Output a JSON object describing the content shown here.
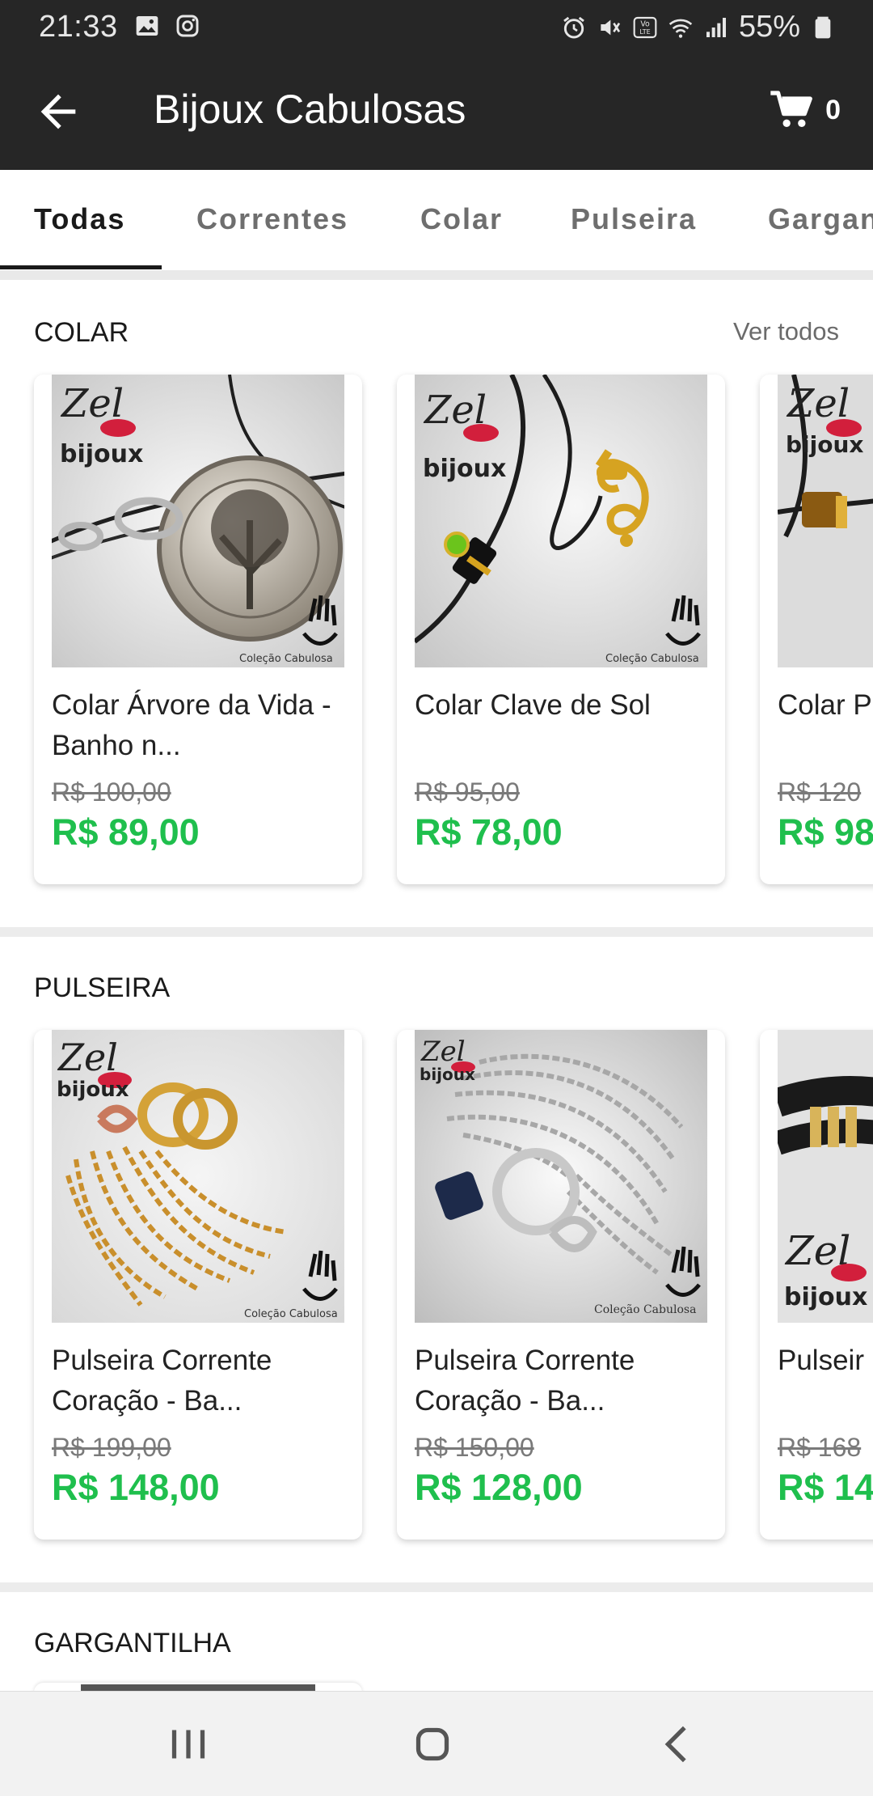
{
  "status": {
    "time": "21:33",
    "battery": "55%"
  },
  "app_bar": {
    "title": "Bijoux Cabulosas",
    "cart_count": "0"
  },
  "tabs": [
    {
      "label": "Todas"
    },
    {
      "label": "Correntes"
    },
    {
      "label": "Colar"
    },
    {
      "label": "Pulseira"
    },
    {
      "label": "Gargan"
    }
  ],
  "sections": [
    {
      "title": "COLAR",
      "see_all": "Ver todos",
      "products": [
        {
          "name": "Colar Árvore da Vida - Banho n...",
          "old_price": "R$ 100,00",
          "price": "R$ 89,00"
        },
        {
          "name": "Colar Clave de Sol",
          "old_price": "R$ 95,00",
          "price": "R$ 78,00"
        },
        {
          "name": "Colar P",
          "old_price": "R$ 120",
          "price": "R$ 98"
        }
      ]
    },
    {
      "title": "PULSEIRA",
      "products": [
        {
          "name": "Pulseira Corrente Coração - Ba...",
          "old_price": "R$ 199,00",
          "price": "R$ 148,00"
        },
        {
          "name": "Pulseira Corrente Coração - Ba...",
          "old_price": "R$ 150,00",
          "price": "R$ 128,00"
        },
        {
          "name": "Pulseir",
          "old_price": "R$ 168",
          "price": "R$ 14"
        }
      ]
    },
    {
      "title": "GARGANTILHA"
    }
  ],
  "brand": {
    "logo_script": "Zel",
    "logo_word": "bijoux",
    "watermark": "Coleção Cabulosa"
  },
  "colors": {
    "app_bar": "#262626",
    "price_green": "#1fbf4d",
    "lips_red": "#d21f3c"
  },
  "icons": {
    "back": "arrow-left-icon",
    "cart": "shopping-cart-icon",
    "nav_recents": "recents-icon",
    "nav_home": "home-icon",
    "nav_back": "nav-back-icon"
  }
}
